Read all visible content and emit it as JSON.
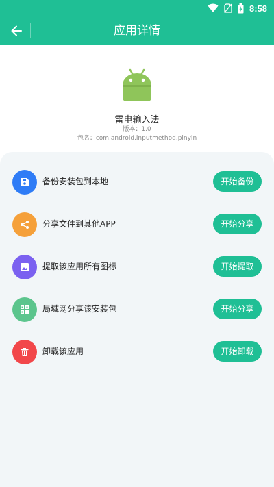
{
  "status_bar": {
    "time": "8:58"
  },
  "app_bar": {
    "title": "应用详情"
  },
  "app": {
    "name": "雷电输入法",
    "version": "版本：1.0",
    "package": "包名：com.android.inputmethod.pinyin"
  },
  "actions": [
    {
      "label": "备份安装包到本地",
      "button": "开始备份",
      "icon": "save-icon",
      "color": "#2f7cf6"
    },
    {
      "label": "分享文件到其他APP",
      "button": "开始分享",
      "icon": "share-icon",
      "color": "#f5a03a"
    },
    {
      "label": "提取该应用所有图标",
      "button": "开始提取",
      "icon": "image-icon",
      "color": "#7b61f0"
    },
    {
      "label": "局域网分享该安装包",
      "button": "开始分享",
      "icon": "qr-code-icon",
      "color": "#5cc58d"
    },
    {
      "label": "卸载该应用",
      "button": "开始卸载",
      "icon": "trash-icon",
      "color": "#f2474a"
    }
  ],
  "colors": {
    "accent": "#1fbf95",
    "panel_bg": "#f2f6f8"
  }
}
